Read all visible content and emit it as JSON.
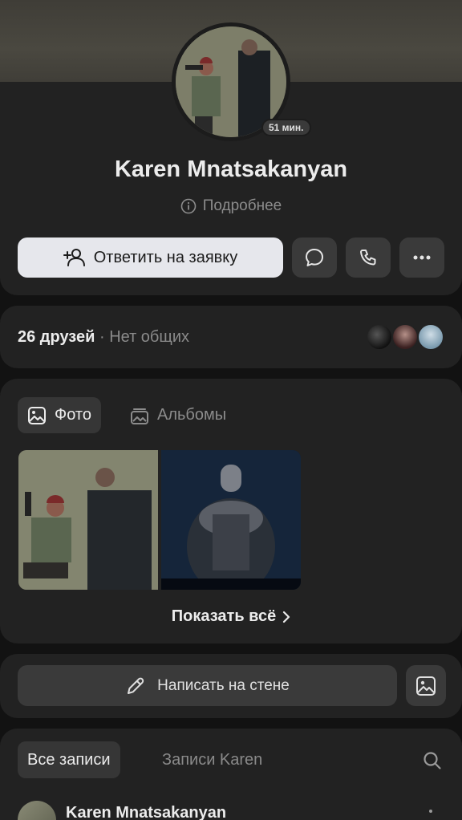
{
  "profile": {
    "name": "Karen Mnatsakanyan",
    "last_seen_badge": "51 мин.",
    "more_link": "Подробнее"
  },
  "actions": {
    "primary_label": "Ответить на заявку",
    "icons": [
      "add-friend-icon",
      "message-icon",
      "phone-icon",
      "more-icon"
    ]
  },
  "friends": {
    "count_label": "26 друзей",
    "separator": " · ",
    "mutual_label": "Нет общих"
  },
  "photos": {
    "tabs": [
      {
        "label": "Фото",
        "icon": "photo-icon",
        "active": true
      },
      {
        "label": "Альбомы",
        "icon": "albums-icon",
        "active": false
      }
    ],
    "show_all_label": "Показать всё"
  },
  "wall": {
    "write_label": "Написать на стене",
    "icons": [
      "pencil-icon",
      "image-icon"
    ]
  },
  "posts": {
    "tabs": [
      {
        "label": "Все записи",
        "active": true
      },
      {
        "label": "Записи Karen",
        "active": false
      }
    ],
    "first_post_author": "Karen Mnatsakanyan"
  },
  "colors": {
    "background": "#121212",
    "card": "#222222",
    "primary_button": "#e6e7ec",
    "secondary_button": "#3a3a3a",
    "muted_text": "#8c8c8c"
  }
}
